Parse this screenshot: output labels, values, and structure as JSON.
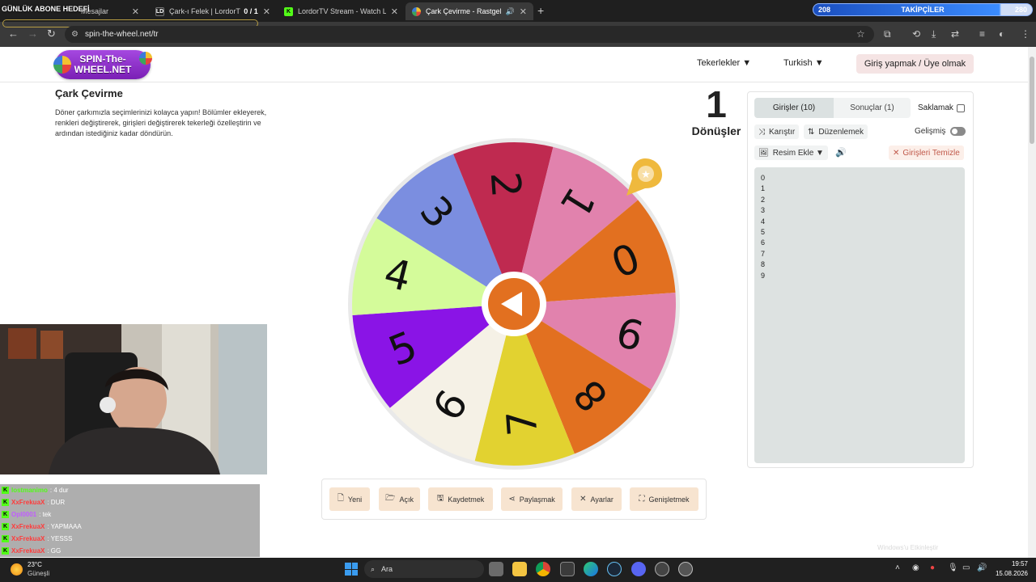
{
  "browser": {
    "tabs": [
      {
        "title": "Mesajlar",
        "favicon": "kick-icon"
      },
      {
        "title": "Çark-ı Felek | LordorTV",
        "badge": "0 / 1",
        "favicon": "ld-icon"
      },
      {
        "title": "LordorTV Stream - Watch Live",
        "favicon": "kick-icon"
      },
      {
        "title": "Çark Çevirme - Rastgele ad",
        "favicon": "wheel-icon"
      }
    ],
    "url": "spin-the-wheel.net/tr"
  },
  "stream_overlay": {
    "goal_label": "GÜNLÜK ABONE HEDEFİ",
    "followers_label": "TAKİPÇİLER",
    "followers_current": "208",
    "followers_target": "280",
    "followers_progress": 0.86
  },
  "site": {
    "logo_line1": "SPIN-The-",
    "logo_line2": "WHEEL.NET",
    "menu_wheels": "Tekerlekler ▼",
    "menu_language": "Turkish ▼",
    "login_button": "Giriş yapmak / Üye olmak",
    "page_title": "Çark Çevirme",
    "page_description": "Döner çarkımızla seçimlerinizi kolayca yapın! Bölümler ekleyerek, renkleri değiştirerek, girişleri değiştirerek tekerleği özelleştirin ve ardından istediğiniz kadar döndürün.",
    "spin_count": "1",
    "spin_label": "Dönüşler"
  },
  "wheel": {
    "segments": [
      {
        "label": "3",
        "color": "#7b8ee0"
      },
      {
        "label": "2",
        "color": "#bf2a50"
      },
      {
        "label": "1",
        "color": "#e182ad"
      },
      {
        "label": "0",
        "color": "#e27020"
      },
      {
        "label": "9",
        "color": "#e182ad"
      },
      {
        "label": "8",
        "color": "#e27020"
      },
      {
        "label": "7",
        "color": "#e2d230"
      },
      {
        "label": "6",
        "color": "#f5f1e6"
      },
      {
        "label": "5",
        "color": "#8a14e6"
      },
      {
        "label": "4",
        "color": "#d4fb9a"
      }
    ],
    "center_color": "#e27020",
    "pointer_color": "#efb93d"
  },
  "toolbar": {
    "new": "Yeni",
    "open": "Açık",
    "save": "Kaydetmek",
    "share": "Paylaşmak",
    "settings": "Ayarlar",
    "expand": "Genişletmek"
  },
  "panel": {
    "tab_entries": "Girişler (10)",
    "tab_results": "Sonuçlar (1)",
    "hide_label": "Saklamak",
    "shuffle": "Karıştır",
    "sort": "Düzenlemek",
    "advanced": "Gelişmiş",
    "add_image": "Resim Ekle ▼",
    "clear": "Girişleri Temizle",
    "entries": [
      "0",
      "1",
      "2",
      "3",
      "4",
      "5",
      "6",
      "7",
      "8",
      "9"
    ]
  },
  "chat": [
    {
      "user": "lostmanimo",
      "message": ": 4 dur",
      "color": "#53fc18"
    },
    {
      "user": "XxFrekuaX",
      "message": ": DUR",
      "color": "#ff3b3b"
    },
    {
      "user": "Opl0001",
      "message": ": tek",
      "color": "#c05cff"
    },
    {
      "user": "XxFrekuaX",
      "message": ": YAPMAAA",
      "color": "#ff3b3b"
    },
    {
      "user": "XxFrekuaX",
      "message": ": YESSS",
      "color": "#ff3b3b"
    },
    {
      "user": "XxFrekuaX",
      "message": ": GG",
      "color": "#ff3b3b"
    }
  ],
  "watermark": "Windows'u Etkinleştir",
  "taskbar": {
    "weather_temp": "23°C",
    "weather_desc": "Güneşli",
    "search_placeholder": "Ara",
    "time": "19:57",
    "date": "15.08.2026"
  }
}
